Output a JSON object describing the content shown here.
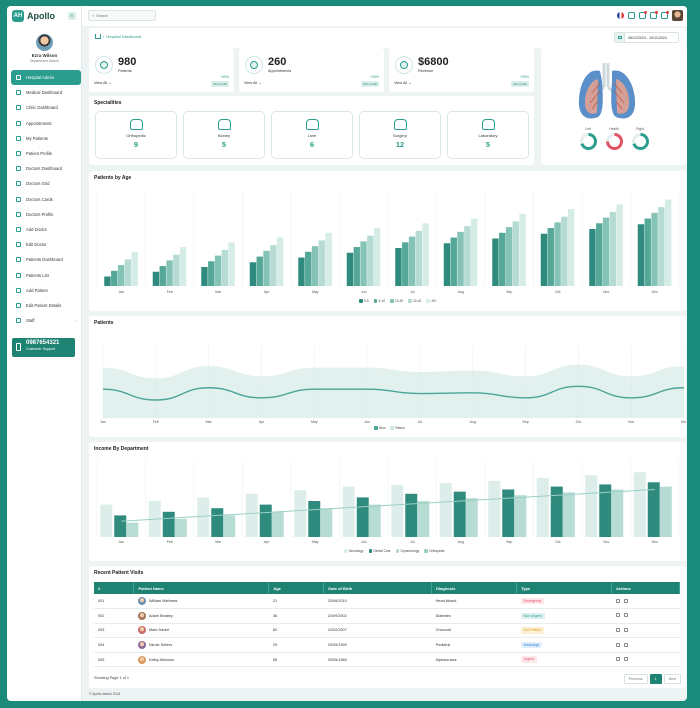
{
  "app": {
    "name": "Apollo",
    "logo_text": "AH"
  },
  "profile": {
    "name": "Ezra Wilson",
    "role": "Department Admin"
  },
  "sidebar": {
    "items": [
      {
        "label": "Hospital Admin",
        "active": true
      },
      {
        "label": "Medical Dashboard"
      },
      {
        "label": "Clinic Dashboard"
      },
      {
        "label": "Appointments"
      },
      {
        "label": "My Patients"
      },
      {
        "label": "Patient Profile"
      },
      {
        "label": "Doctors Dashboard"
      },
      {
        "label": "Doctors Grid"
      },
      {
        "label": "Doctors Cards"
      },
      {
        "label": "Doctors Profile"
      },
      {
        "label": "Add Doctor"
      },
      {
        "label": "Edit Doctor"
      },
      {
        "label": "Patients Dashboard"
      },
      {
        "label": "Patients List"
      },
      {
        "label": "Add Patient"
      },
      {
        "label": "Edit Patient Details"
      },
      {
        "label": "Staff",
        "has_children": true
      }
    ]
  },
  "support": {
    "number": "0987654321",
    "label": "Customer Support"
  },
  "search": {
    "placeholder": "Search"
  },
  "breadcrumb": {
    "current": "Hospital Dashboard"
  },
  "date_range": "08/12/2024 - 10/11/2024",
  "stats": [
    {
      "value": "980",
      "label": "Patients",
      "pct": "+40%",
      "view": "View All",
      "badge": "this month"
    },
    {
      "value": "260",
      "label": "Appointments",
      "pct": "+30%",
      "view": "View All",
      "badge": "this month"
    },
    {
      "value": "$6800",
      "label": "Revenue",
      "pct": "+20%",
      "view": "View All",
      "badge": "this month"
    }
  ],
  "specialities": {
    "title": "Specialities",
    "items": [
      {
        "name": "Orthopedic",
        "value": "9"
      },
      {
        "name": "Kidney",
        "value": "5"
      },
      {
        "name": "Liver",
        "value": "6"
      },
      {
        "name": "Surgery",
        "value": "12"
      },
      {
        "name": "Laboratory",
        "value": "5"
      }
    ]
  },
  "lungs": {
    "labels": [
      "Left",
      "Health",
      "Right"
    ],
    "levels": [
      0.7,
      0.75,
      0.7
    ],
    "colors": [
      "#2a9d8f",
      "#e05262",
      "#2a9d8f"
    ]
  },
  "patients_by_age": {
    "title": "Patients by Age"
  },
  "patients_chart": {
    "title": "Patients"
  },
  "income_chart": {
    "title": "Income By Department"
  },
  "chart_data": [
    {
      "type": "bar",
      "title": "Patients by Age",
      "categories": [
        "Jan",
        "Feb",
        "Mar",
        "Apr",
        "May",
        "Jun",
        "Jul",
        "Aug",
        "Sep",
        "Oct",
        "Nov",
        "Dec"
      ],
      "series": [
        {
          "name": "0-5",
          "color": "#2e8b7d",
          "values": [
            10,
            15,
            20,
            25,
            30,
            35,
            40,
            45,
            50,
            55,
            60,
            65
          ]
        },
        {
          "name": "6-10",
          "color": "#55a898",
          "values": [
            16,
            21,
            26,
            31,
            36,
            41,
            46,
            51,
            56,
            61,
            66,
            71
          ]
        },
        {
          "name": "10-20",
          "color": "#86c3b7",
          "values": [
            22,
            27,
            32,
            37,
            42,
            47,
            52,
            57,
            62,
            67,
            72,
            77
          ]
        },
        {
          "name": "20-40",
          "color": "#b5dbd3",
          "values": [
            28,
            33,
            38,
            43,
            48,
            53,
            58,
            63,
            68,
            73,
            78,
            83
          ]
        },
        {
          "name": "40+",
          "color": "#d6ece7",
          "values": [
            36,
            41,
            46,
            51,
            56,
            61,
            66,
            71,
            76,
            81,
            86,
            91
          ]
        }
      ],
      "ylim": [
        0,
        100
      ]
    },
    {
      "type": "area",
      "title": "Patients",
      "categories": [
        "Jan",
        "Feb",
        "Mar",
        "Apr",
        "May",
        "Jun",
        "Jul",
        "Aug",
        "Sep",
        "Oct",
        "Nov",
        "Dec"
      ],
      "series": [
        {
          "name": "New",
          "color": "#4aa596",
          "values": [
            40,
            25,
            42,
            28,
            40,
            40,
            34,
            35,
            28,
            44,
            28,
            42
          ]
        },
        {
          "name": "Return",
          "color": "#cfe8e3",
          "values": [
            70,
            55,
            72,
            58,
            70,
            70,
            64,
            66,
            58,
            74,
            58,
            72
          ]
        }
      ],
      "ylim": [
        0,
        100
      ]
    },
    {
      "type": "bar",
      "title": "Income By Department",
      "categories": [
        "Jan",
        "Feb",
        "Mar",
        "Apr",
        "May",
        "Jun",
        "Jul",
        "Aug",
        "Sep",
        "Oct",
        "Nov",
        "Dec"
      ],
      "series": [
        {
          "name": "Neurology",
          "color": "#ddeeea",
          "values": [
            45,
            50,
            55,
            60,
            65,
            70,
            72,
            75,
            78,
            82,
            86,
            90
          ]
        },
        {
          "name": "Dental Care",
          "color": "#2e8b7d",
          "values": [
            30,
            35,
            40,
            45,
            50,
            55,
            60,
            63,
            66,
            70,
            73,
            76
          ]
        },
        {
          "name": "Gynaecology",
          "color": "#b7dcd4",
          "values": [
            20,
            25,
            30,
            35,
            40,
            45,
            50,
            54,
            58,
            62,
            66,
            70
          ]
        },
        {
          "name": "Orthopedic",
          "color": "#9bcfc5",
          "values": [
            22,
            26,
            30,
            34,
            38,
            42,
            46,
            50,
            54,
            58,
            62,
            66
          ]
        }
      ],
      "ylim": [
        0,
        100
      ]
    }
  ],
  "visits": {
    "title": "Recent Patient Visits",
    "headers": [
      "#",
      "Patient Name",
      "Age",
      "Date of Birth",
      "Diagnosis",
      "Type",
      "Actions"
    ],
    "rows": [
      {
        "id": "001",
        "name": "William Mathews",
        "age": "21",
        "dob": "20/06/2010",
        "diagnosis": "Heart Attack",
        "type": "Emergency",
        "type_color": "#e05262",
        "type_bg": "#fde7ea"
      },
      {
        "id": "002",
        "name": "Adam Bradley",
        "age": "36",
        "dob": "24/09/2002",
        "diagnosis": "Diabetes",
        "type": "Non Urgent",
        "type_color": "#2a9d8f",
        "type_bg": "#dcf1ed"
      },
      {
        "id": "003",
        "name": "Mark Daniel",
        "age": "82",
        "dob": "22/02/2007",
        "diagnosis": "Charcoid",
        "type": "Out Patient",
        "type_color": "#e0a21a",
        "type_bg": "#fbf0d6"
      },
      {
        "id": "004",
        "name": "Nicole Sellers",
        "age": "29",
        "dob": "29/09/1999",
        "diagnosis": "Pediatric",
        "type": "Discharge",
        "type_color": "#2a7fd5",
        "type_bg": "#dfeefb"
      },
      {
        "id": "005",
        "name": "Kathy Atkinson",
        "age": "58",
        "dob": "20/05/1989",
        "diagnosis": "Alphacruses",
        "type": "Urgent",
        "type_color": "#e05262",
        "type_bg": "#fde7ea"
      }
    ],
    "showing": "Showing Page 1 of 1",
    "pager": {
      "prev": "Previous",
      "page": "1",
      "next": "Next"
    }
  },
  "footer": "© Apollo admin 2024"
}
